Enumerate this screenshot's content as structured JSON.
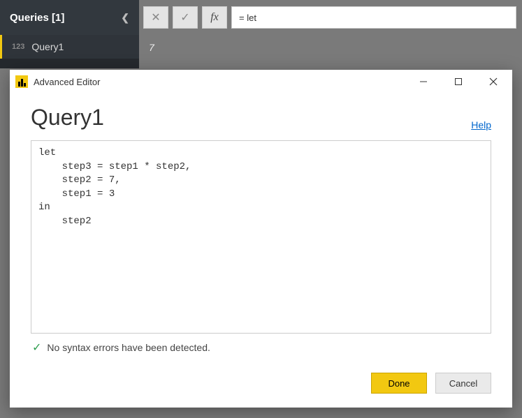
{
  "sidebar": {
    "header": "Queries [1]",
    "items": [
      {
        "type_label": "123",
        "name": "Query1"
      }
    ]
  },
  "formula_bar": {
    "cancel_glyph": "✕",
    "commit_glyph": "✓",
    "fx_label": "fx",
    "value": "= let"
  },
  "result": {
    "value": "7"
  },
  "dialog": {
    "window_title": "Advanced Editor",
    "query_name": "Query1",
    "help_label": "Help",
    "code": "let\n    step3 = step1 * step2,\n    step2 = 7,\n    step1 = 3\nin\n    step2",
    "status_text": "No syntax errors have been detected.",
    "buttons": {
      "done": "Done",
      "cancel": "Cancel"
    }
  }
}
